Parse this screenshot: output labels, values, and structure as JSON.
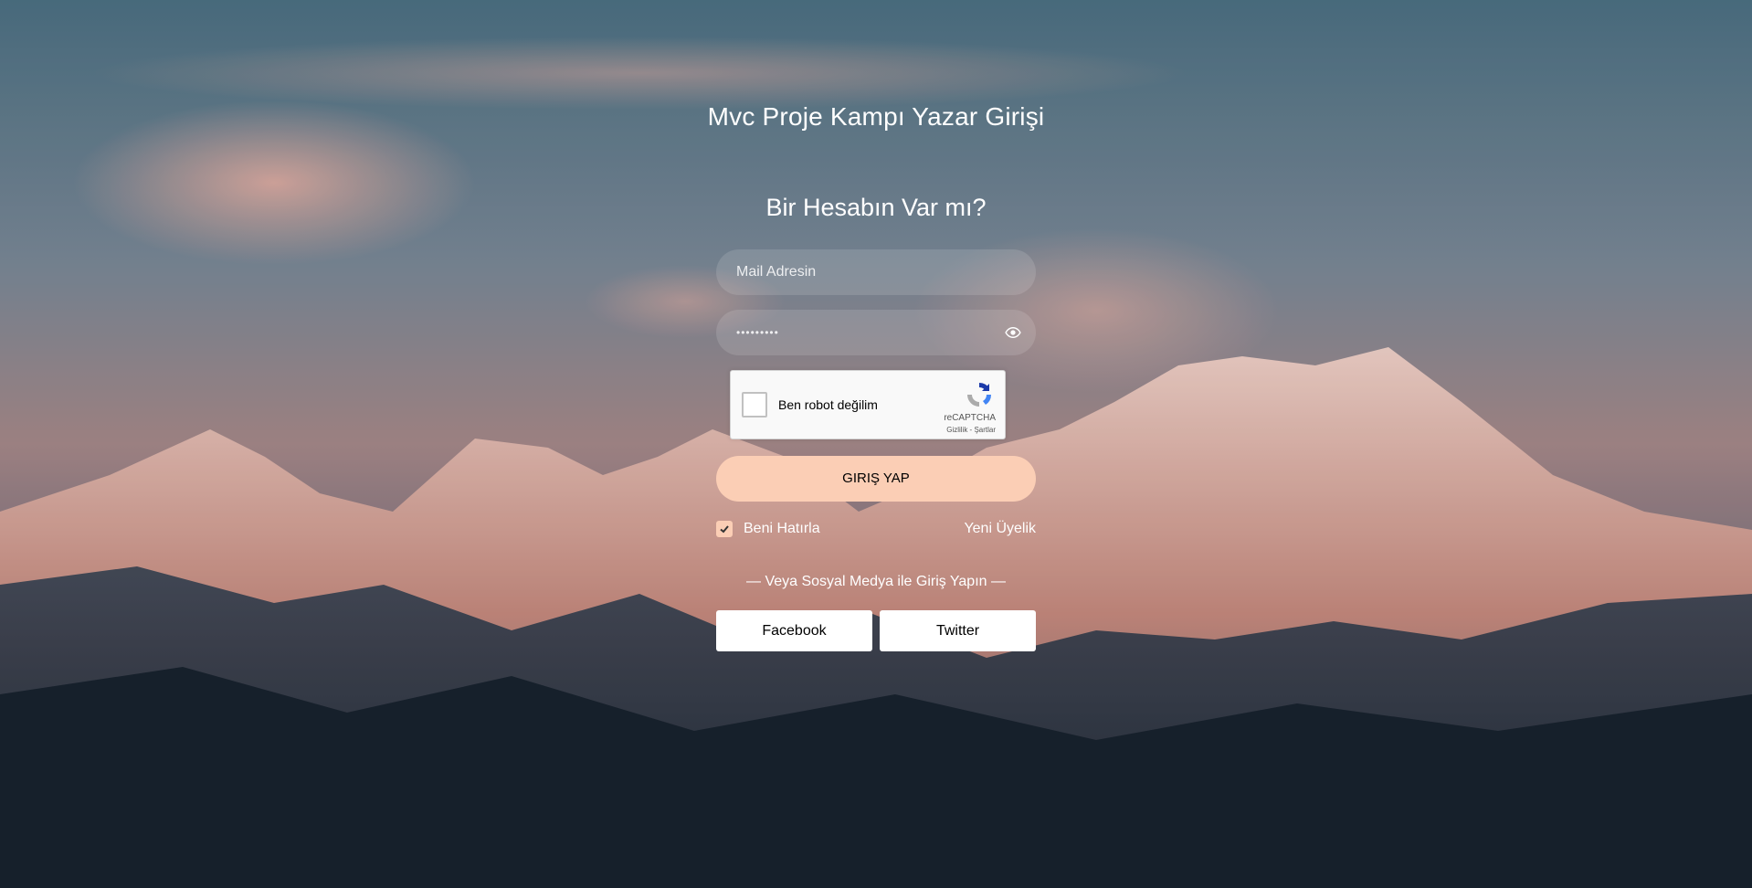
{
  "page": {
    "title": "Mvc Proje Kampı Yazar Girişi",
    "subtitle": "Bir Hesabın Var mı?"
  },
  "form": {
    "mail_placeholder": "Mail Adresin",
    "password_value": "•••••••••",
    "captcha": {
      "label": "Ben robot değilim",
      "brand": "reCAPTCHA",
      "terms": "Gizlilik - Şartlar"
    },
    "login_button": "GIRIŞ YAP",
    "remember_label": "Beni Hatırla",
    "remember_checked": true,
    "new_member_link": "Yeni Üyelik"
  },
  "social": {
    "divider_text": "— Veya Sosyal Medya ile Giriş Yapın —",
    "facebook_label": "Facebook",
    "twitter_label": "Twitter"
  },
  "colors": {
    "accent": "#fbceb5",
    "text": "#ffffff"
  },
  "icons": [
    "eye-icon",
    "recaptcha-logo-icon",
    "check-icon"
  ]
}
